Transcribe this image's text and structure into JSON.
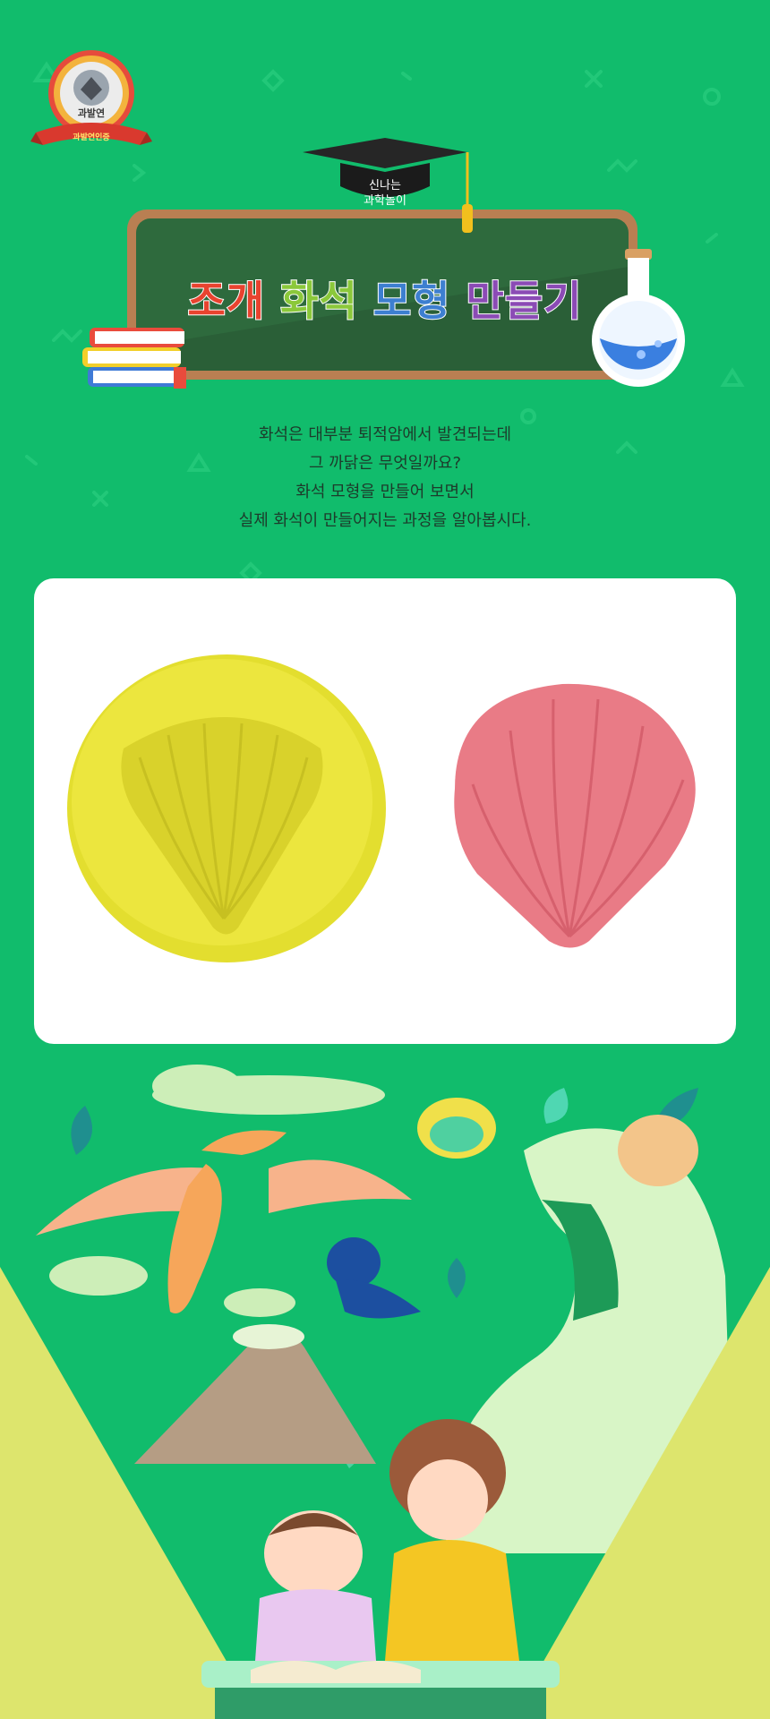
{
  "badge": {
    "name": "과발연",
    "ribbon": "과발연인증"
  },
  "cap_label": [
    "신나는",
    "과학놀이"
  ],
  "title": {
    "words": [
      {
        "text": "조개",
        "color": "#e8432f"
      },
      {
        "text": "화석",
        "color": "#8bc83a"
      },
      {
        "text": "모형",
        "color": "#3d7fd0"
      },
      {
        "text": "만들기",
        "color": "#8b4bb5"
      }
    ]
  },
  "intro": {
    "lines": [
      "화석은 대부분 퇴적암에서 발견되는데",
      "그 까닭은 무엇일까요?",
      "화석 모형을 만들어 보면서",
      "실제 화석이 만들어지는 과정을 알아봅시다."
    ]
  },
  "colors": {
    "background": "#11bc6c",
    "board": "#2e6a3d",
    "board_frame": "#b97f52",
    "yellow_clay": "#e8e23a",
    "pink_clay": "#e97b86"
  }
}
